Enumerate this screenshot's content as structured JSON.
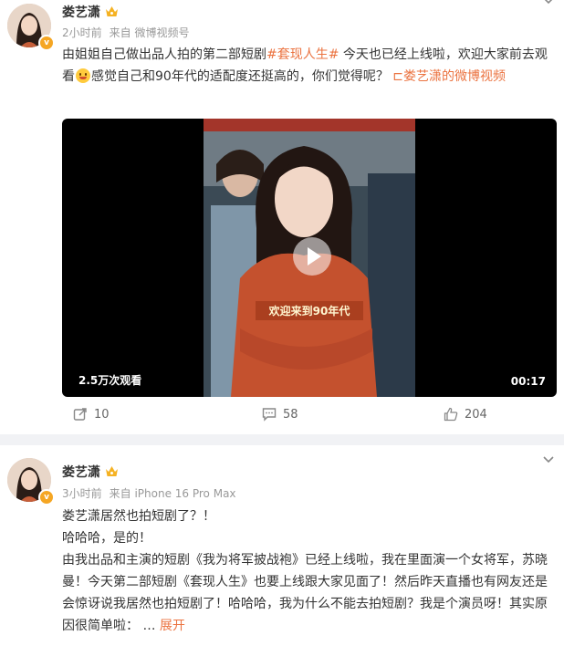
{
  "posts": [
    {
      "author": "娄艺潇",
      "time": "2小时前",
      "source": "来自 微博视频号",
      "text_a": "由姐姐自己做出品人拍的第二部短剧",
      "topic": "#套现人生#",
      "text_b": " 今天也已经上线啦，欢迎大家前去观看",
      "text_c": "感觉自己和90年代的适配度还挺高的，你们觉得呢？ ",
      "video_link_icon": "⊏",
      "video_link": "娄艺潇的微博视频",
      "video": {
        "views": "2.5万次观看",
        "duration": "00:17",
        "overlay_caption": "欢迎来到90年代"
      },
      "stats": {
        "reposts": "10",
        "comments": "58",
        "likes": "204"
      }
    },
    {
      "author": "娄艺潇",
      "time": "3小时前",
      "source": "来自 iPhone 16 Pro Max",
      "line1": "娄艺潇居然也拍短剧了？！",
      "line2": "哈哈哈，是的！",
      "para": "由我出品和主演的短剧《我为将军披战袍》已经上线啦，我在里面演一个女将军，苏晓曼！今天第二部短剧《套现人生》也要上线跟大家见面了！然后昨天直播也有网友还是会惊讶说我居然也拍短剧了！哈哈哈，我为什么不能去拍短剧？我是个演员呀！其实原因很简单啦：",
      "ellipsis": " … ",
      "expand": "展开"
    }
  ],
  "colors": {
    "accent": "#eb7340",
    "badge": "#f5a623",
    "muted": "#999999"
  },
  "icons": [
    "crown-icon",
    "verified-icon",
    "chevron-down-icon",
    "repost-icon",
    "comment-icon",
    "like-icon",
    "play-icon",
    "video-link-icon"
  ]
}
